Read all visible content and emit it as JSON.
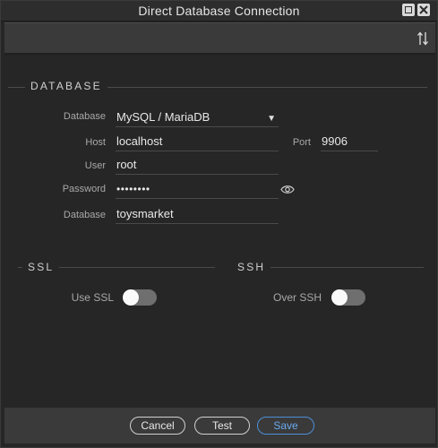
{
  "window": {
    "title": "Direct Database Connection"
  },
  "sections": {
    "database": "DATABASE",
    "ssl": "SSL",
    "ssh": "SSH"
  },
  "form": {
    "database_type_label": "Database",
    "database_type_value": "MySQL / MariaDB",
    "host_label": "Host",
    "host_value": "localhost",
    "port_label": "Port",
    "port_value": "9906",
    "user_label": "User",
    "user_value": "root",
    "password_label": "Password",
    "password_value": "••••••••",
    "database_name_label": "Database",
    "database_name_value": "toysmarket"
  },
  "ssl": {
    "use_ssl_label": "Use SSL",
    "use_ssl_on": false
  },
  "ssh": {
    "over_ssh_label": "Over SSH",
    "over_ssh_on": false
  },
  "footer": {
    "cancel_label": "Cancel",
    "test_label": "Test",
    "save_label": "Save"
  },
  "colors": {
    "background": "#262626",
    "accent": "#4d8fd6",
    "toolbar": "#3a3a3a"
  },
  "icons": [
    "maximize-icon",
    "close-icon",
    "sort-icon",
    "eye-icon"
  ]
}
